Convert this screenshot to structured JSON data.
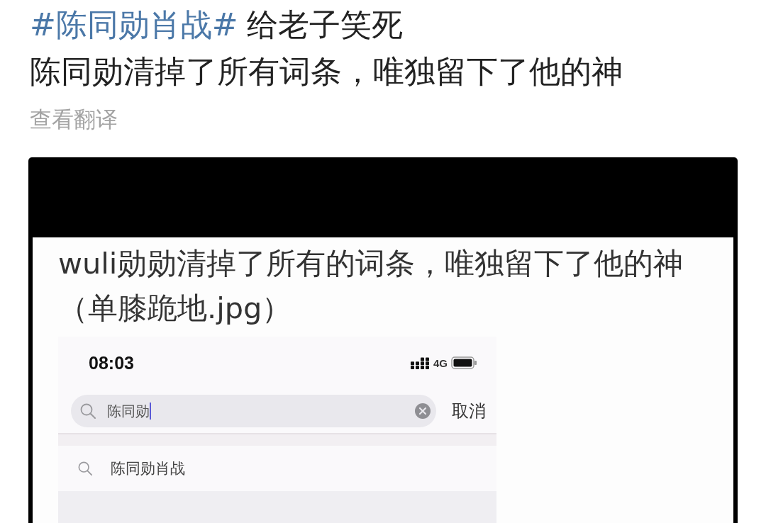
{
  "post": {
    "hashtag": "#陈同勋肖战#",
    "line_1": "给老子笑死",
    "line_2": "陈同勋清掉了所有词条，唯独留下了他的神",
    "translate_link": "查看翻译"
  },
  "image": {
    "caption_lines": [
      "wuli勋勋清掉了所有的词条，唯独留下了他的神",
      "（单膝跪地.jpg）"
    ],
    "phone": {
      "status_bar": {
        "time": "08:03",
        "network": "4G"
      },
      "search": {
        "value": "陈同勋",
        "focused": true,
        "cancel": "取消"
      },
      "suggestions": [
        {
          "text": "陈同勋肖战"
        }
      ]
    }
  }
}
